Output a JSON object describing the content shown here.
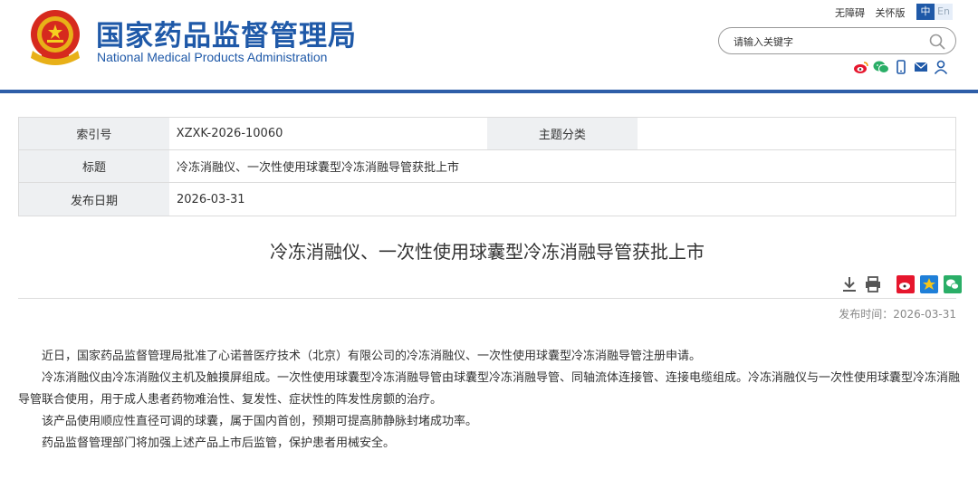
{
  "header": {
    "title_cn": "国家药品监督管理局",
    "title_en": "National Medical Products Administration",
    "top_links": [
      "无障碍",
      "关怀版"
    ],
    "lang_zh": "中",
    "lang_en": "En",
    "search_placeholder": "请输入关键字",
    "brand_color": "#1f59a8",
    "social_icons": [
      "weibo-icon",
      "wechat-icon",
      "mobile-icon",
      "mail-icon",
      "user-icon"
    ]
  },
  "info_table": {
    "index_label": "索引号",
    "index_value": "XZXK-2026-10060",
    "category_label": "主题分类",
    "category_value": "",
    "title_label": "标题",
    "title_value": "冷冻消融仪、一次性使用球囊型冷冻消融导管获批上市",
    "date_label": "发布日期",
    "date_value": "2026-03-31"
  },
  "article": {
    "title": "冷冻消融仪、一次性使用球囊型冷冻消融导管获批上市",
    "publish_time": "发布时间：2026-03-31",
    "paragraphs": [
      "近日，国家药品监督管理局批准了心诺普医疗技术（北京）有限公司的冷冻消融仪、一次性使用球囊型冷冻消融导管注册申请。",
      "冷冻消融仪由冷冻消融仪主机及触摸屏组成。一次性使用球囊型冷冻消融导管由球囊型冷冻消融导管、同轴流体连接管、连接电缆组成。冷冻消融仪与一次性使用球囊型冷冻消融导管联合使用，用于成人患者药物难治性、复发性、症状性的阵发性房颤的治疗。",
      "该产品使用顺应性直径可调的球囊，属于国内首创，预期可提高肺静脉封堵成功率。",
      "药品监督管理部门将加强上述产品上市后监管，保护患者用械安全。"
    ],
    "tool_icons": [
      "download-icon",
      "print-icon",
      "weibo-share-icon",
      "favorite-icon",
      "wechat-share-icon"
    ]
  }
}
